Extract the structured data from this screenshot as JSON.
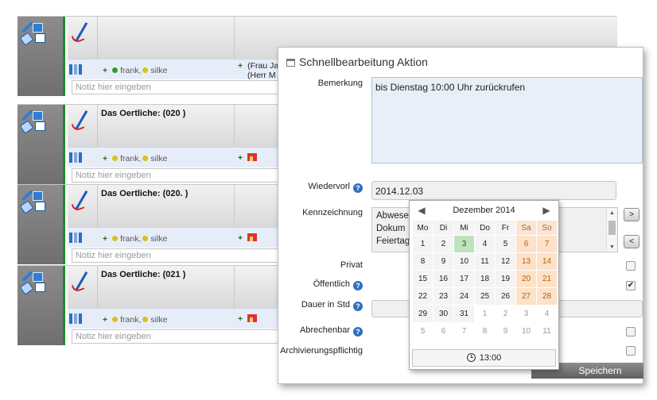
{
  "rows": [
    {
      "header": "",
      "names": [
        "frank,",
        "silke"
      ],
      "dot_colors": [
        "#2f9e2f",
        "#d8c21a"
      ],
      "cell2": [
        "(Frau Ja",
        "(Herr M"
      ],
      "note_placeholder": "Notiz hier eingeben"
    },
    {
      "header": "Das Oertliche: (020          )",
      "names": [
        "frank,",
        "silke"
      ],
      "dot_colors": [
        "#d8c21a",
        "#d8c21a"
      ],
      "cell2": [],
      "note_placeholder": "Notiz hier eingeben"
    },
    {
      "header": "Das Oertliche: (020.          )",
      "names": [
        "frank,",
        "silke"
      ],
      "dot_colors": [
        "#d8c21a",
        "#d8c21a"
      ],
      "cell2": [],
      "note_placeholder": "Notiz hier eingeben"
    },
    {
      "header": "Das Oertliche: (021          )",
      "names": [
        "frank,",
        "silke"
      ],
      "dot_colors": [
        "#d8c21a",
        "#d8c21a"
      ],
      "cell2": [],
      "note_placeholder": "Notiz hier eingeben"
    }
  ],
  "dialog": {
    "title": "Schnellbearbeitung Aktion",
    "labels": {
      "bemerkung": "Bemerkung",
      "wiedervorl": "Wiedervorl",
      "kennzeichnung": "Kennzeichnung",
      "privat": "Privat",
      "oeffentlich": "Öffentlich",
      "dauer": "Dauer in Std",
      "abrechenbar": "Abrechenbar",
      "archivierung": "Archivierungspflichtig"
    },
    "bemerkung_value": "bis Dienstag 10:00 Uhr zurückrufen",
    "wiedervorl_value": "2014.12.03",
    "kennzeichnung_options": [
      "Abwese",
      "Dokum",
      "Feiertag"
    ],
    "btn_right": ">",
    "btn_left": "<",
    "oeffentlich_check": "✔",
    "save_label": "Speichern",
    "help_glyph": "?"
  },
  "calendar": {
    "month_label": "Dezember 2014",
    "prev": "◀",
    "next": "▶",
    "weekdays": [
      "Mo",
      "Di",
      "Mi",
      "Do",
      "Fr",
      "Sa",
      "So"
    ],
    "weeks": [
      [
        "1",
        "2",
        "3",
        "4",
        "5",
        "6",
        "7"
      ],
      [
        "8",
        "9",
        "10",
        "11",
        "12",
        "13",
        "14"
      ],
      [
        "15",
        "16",
        "17",
        "18",
        "19",
        "20",
        "21"
      ],
      [
        "22",
        "23",
        "24",
        "25",
        "26",
        "27",
        "28"
      ],
      [
        "29",
        "30",
        "31",
        "1",
        "2",
        "3",
        "4"
      ],
      [
        "5",
        "6",
        "7",
        "8",
        "9",
        "10",
        "11"
      ]
    ],
    "today": "3",
    "time": "13:00",
    "colors": {
      "weekend": "#fde2c8",
      "today": "#bfe3bf"
    }
  },
  "icons": [
    "pencil-icon",
    "window-icon",
    "tag-icon",
    "document-icon",
    "signature-icon",
    "phone-list-icon",
    "house-icon",
    "help-icon",
    "clock-icon"
  ]
}
